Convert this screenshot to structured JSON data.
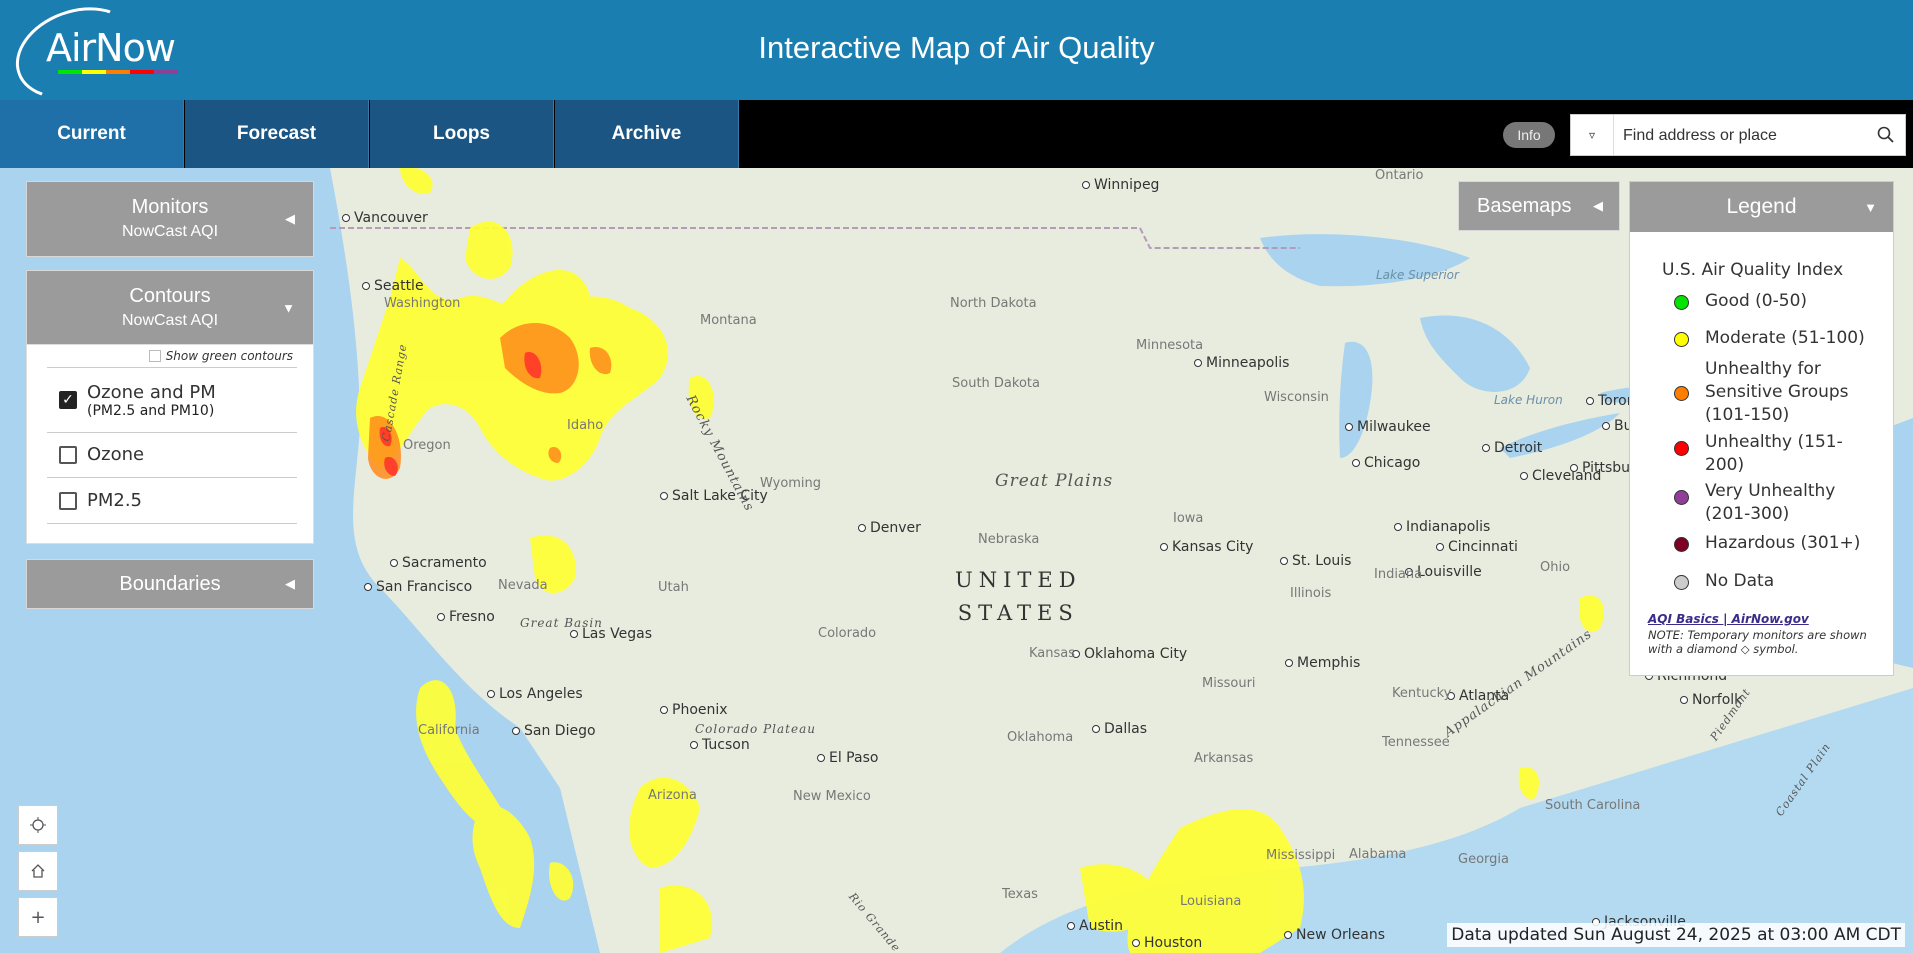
{
  "header": {
    "logo_text": "AirNow",
    "title": "Interactive Map of Air Quality"
  },
  "nav": {
    "tabs": [
      "Current",
      "Forecast",
      "Loops",
      "Archive"
    ],
    "active": "Current"
  },
  "toolbar": {
    "info_label": "Info",
    "search_placeholder": "Find address or place"
  },
  "panels": {
    "monitors": {
      "title": "Monitors",
      "subtitle": "NowCast AQI"
    },
    "contours": {
      "title": "Contours",
      "subtitle": "NowCast AQI",
      "green_option": "Show green contours",
      "options": [
        {
          "label": "Ozone and PM",
          "sub": "(PM2.5 and PM10)",
          "checked": true
        },
        {
          "label": "Ozone",
          "sub": "",
          "checked": false
        },
        {
          "label": "PM2.5",
          "sub": "",
          "checked": false
        }
      ]
    },
    "boundaries": {
      "title": "Boundaries"
    }
  },
  "basemaps": {
    "label": "Basemaps"
  },
  "legend": {
    "head": "Legend",
    "title": "U.S. Air Quality Index",
    "items": [
      {
        "label": "Good (0-50)",
        "color": "#00e400"
      },
      {
        "label": "Moderate (51-100)",
        "color": "#ffff00"
      },
      {
        "label": "Unhealthy for Sensitive Groups (101-150)",
        "color": "#ff7e00"
      },
      {
        "label": "Unhealthy (151-200)",
        "color": "#ff0000"
      },
      {
        "label": "Very Unhealthy (201-300)",
        "color": "#8f3f97"
      },
      {
        "label": "Hazardous (301+)",
        "color": "#7e0023"
      },
      {
        "label": "No Data",
        "color": "#cccccc"
      }
    ],
    "link": "AQI Basics | AirNow.gov",
    "note": "NOTE: Temporary monitors are shown with a diamond ◇ symbol."
  },
  "map": {
    "cities": [
      "Vancouver",
      "Seattle",
      "Winnipeg",
      "Minneapolis",
      "Milwaukee",
      "Chicago",
      "Detroit",
      "Cleveland",
      "Toronto",
      "Buffalo",
      "Pittsburgh",
      "Salt Lake City",
      "Denver",
      "Kansas City",
      "St. Louis",
      "Indianapolis",
      "Cincinnati",
      "Louisville",
      "Sacramento",
      "San Francisco",
      "Fresno",
      "Las Vegas",
      "Los Angeles",
      "San Diego",
      "Phoenix",
      "Tucson",
      "El Paso",
      "Oklahoma City",
      "Memphis",
      "Dallas",
      "Atlanta",
      "Richmond",
      "Norfolk",
      "Austin",
      "Houston",
      "New Orleans",
      "Jacksonville"
    ],
    "states": [
      "Washington",
      "Montana",
      "North Dakota",
      "Minnesota",
      "South Dakota",
      "Wisconsin",
      "Oregon",
      "Idaho",
      "Wyoming",
      "Iowa",
      "Nebraska",
      "Nevada",
      "Utah",
      "Colorado",
      "Kansas",
      "Missouri",
      "Illinois",
      "Indiana",
      "Ohio",
      "Kentucky",
      "California",
      "Oklahoma",
      "Arizona",
      "New Mexico",
      "Arkansas",
      "Tennessee",
      "Alabama",
      "Georgia",
      "Mississippi",
      "Louisiana",
      "Texas",
      "South Carolina",
      "Ontario"
    ],
    "regions": [
      "Great Plains",
      "Rocky Mountains",
      "Great Basin",
      "Colorado Plateau",
      "Appalachian Mountains",
      "Cascade Range",
      "Coastal Plain",
      "Piedmont",
      "Rio Grande"
    ],
    "water": [
      "Lake Superior",
      "Lake Huron"
    ],
    "country": "UNITED\nSTATES"
  },
  "status": {
    "data_updated": "Data updated Sun August 24, 2025 at 03:00 AM CDT"
  }
}
